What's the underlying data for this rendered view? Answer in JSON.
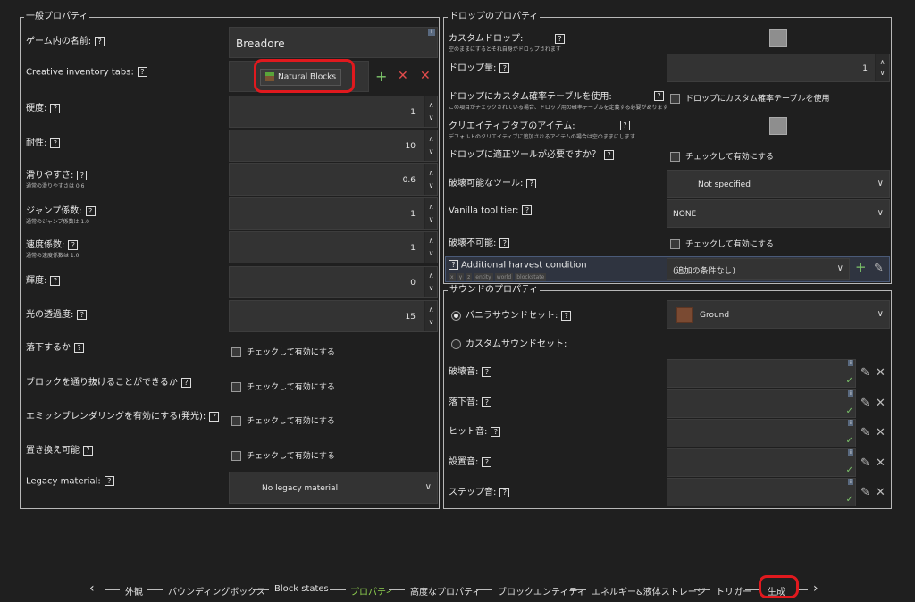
{
  "colors": {
    "accent_green": "#7cc46a",
    "accent_red": "#e0191e",
    "active_nav": "#8fd14f"
  },
  "general": {
    "legend": "一般プロパティ",
    "name_label": "ゲーム内の名前:",
    "name_value": "Breadore",
    "tabs_label": "Creative inventory tabs:",
    "tab_chip": "Natural Blocks",
    "hardness_label": "硬度:",
    "hardness_value": "1",
    "resistance_label": "耐性:",
    "resistance_value": "10",
    "slipperiness_label": "滑りやすさ:",
    "slipperiness_sub": "通常の滑りやすさは 0.6",
    "slipperiness_value": "0.6",
    "jump_label": "ジャンプ係数:",
    "jump_sub": "通常のジャンプ係数は 1.0",
    "jump_value": "1",
    "speed_label": "速度係数:",
    "speed_sub": "通常の速度係数は 1.0",
    "speed_value": "1",
    "luminance_label": "輝度:",
    "luminance_value": "0",
    "light_opacity_label": "光の透過度:",
    "light_opacity_value": "15",
    "gravity_label": "落下するか",
    "passable_label": "ブロックを通り抜けることができるか",
    "emissive_label": "エミッシブレンダリングを有効にする(発光):",
    "replaceable_label": "置き換え可能",
    "checkbox_text": "チェックして有効にする",
    "legacy_label": "Legacy material:",
    "legacy_value": "No legacy material"
  },
  "drop": {
    "legend": "ドロップのプロパティ",
    "custom_drop_label": "カスタムドロップ:",
    "custom_drop_sub": "空のままにするとそれ自身がドロップされます",
    "drop_amount_label": "ドロップ量:",
    "drop_amount_value": "1",
    "loot_table_label": "ドロップにカスタム確率テーブルを使用:",
    "loot_table_sub": "この項目がチェックされている場合、ドロップ用の確率テーブルを定義する必要があります",
    "loot_table_check": "ドロップにカスタム確率テーブルを使用",
    "creative_item_label": "クリエイティブタブのアイテム:",
    "creative_item_sub": "デフォルトのクリエイティブに追加されるアイテムの場合は空のままにします",
    "requires_tool_label": "ドロップに適正ツールが必要ですか？",
    "requires_tool_check": "チェックして有効にする",
    "tool_label": "破壊可能なツール:",
    "tool_value": "Not specified",
    "tier_label": "Vanilla tool tier:",
    "tier_value": "NONE",
    "unbreakable_label": "破壊不可能:",
    "unbreakable_check": "チェックして有効にする",
    "harvest_label": "Additional harvest condition",
    "harvest_tags": [
      "x",
      "y",
      "z",
      "entity",
      "world",
      "blockstate"
    ],
    "harvest_value": "(追加の条件なし)"
  },
  "sound": {
    "legend": "サウンドのプロパティ",
    "vanilla_label": "バニラサウンドセット:",
    "vanilla_value": "Ground",
    "custom_label": "カスタムサウンドセット:",
    "break_label": "破壊音:",
    "fall_label": "落下音:",
    "hit_label": "ヒット音:",
    "place_label": "設置音:",
    "step_label": "ステップ音:"
  },
  "nav": {
    "items": [
      "外観",
      "バウンディングボックス",
      "Block states",
      "プロパティ",
      "高度なプロパティ",
      "ブロックエンティティ",
      "エネルギー&液体ストレージ",
      "トリガー",
      "生成"
    ],
    "active": "プロパティ",
    "highlighted": "生成"
  }
}
